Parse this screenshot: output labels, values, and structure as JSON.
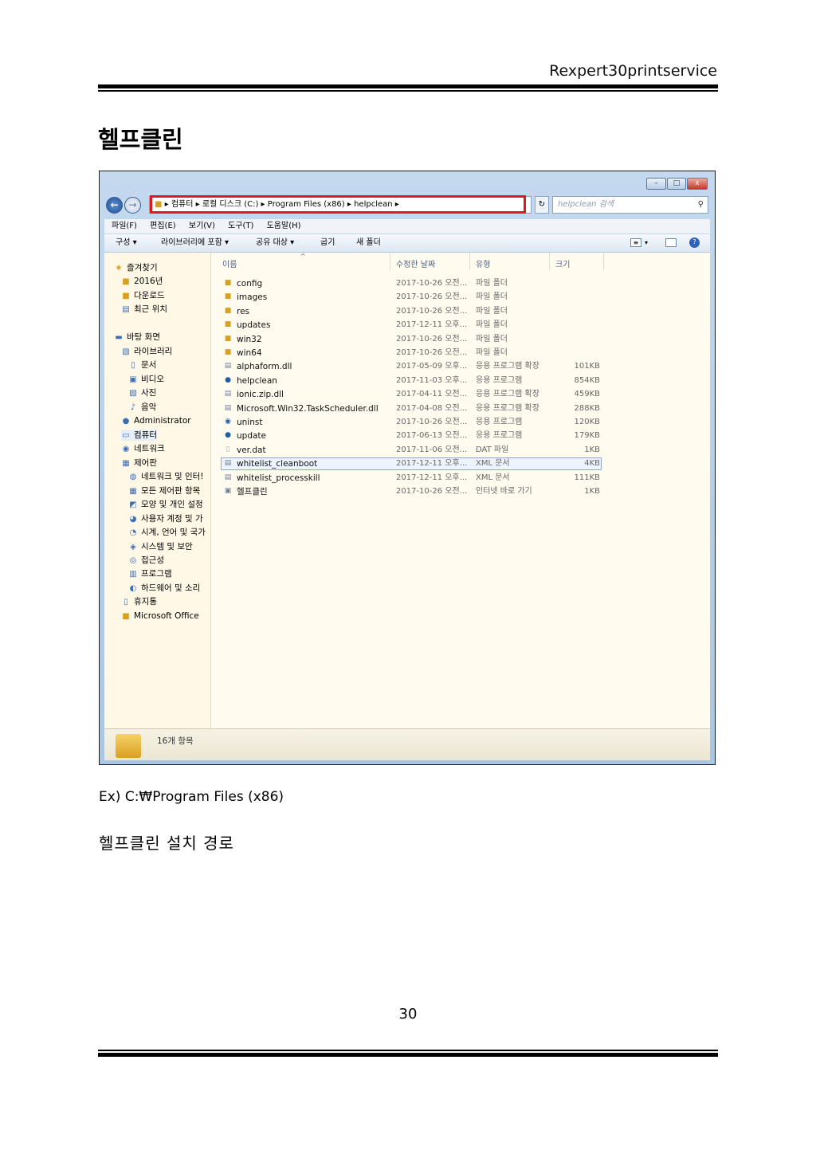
{
  "header": {
    "doc_title": "Rexpert30printservice"
  },
  "heading": "헬프클린",
  "window": {
    "controls": {
      "minimize": "–",
      "maximize": "□",
      "close": "x"
    },
    "nav": {
      "back_icon": "back-arrow-icon",
      "forward_icon": "forward-arrow-icon"
    },
    "address": {
      "segments": [
        "컴퓨터",
        "로컬 디스크 (C:)",
        "Program Files (x86)",
        "helpclean"
      ]
    },
    "search_placeholder": "helpclean 검색",
    "menu": [
      "파일(F)",
      "편집(E)",
      "보기(V)",
      "도구(T)",
      "도움말(H)"
    ],
    "commands": [
      "구성 ▾",
      "라이브러리에 포함 ▾",
      "공유 대상 ▾",
      "굽기",
      "새 폴더"
    ],
    "sidebar": [
      {
        "label": "즐겨찾기",
        "icon": "star-icon",
        "indent": 0
      },
      {
        "label": "2016년",
        "icon": "folder-icon",
        "indent": 1
      },
      {
        "label": "다운로드",
        "icon": "download-folder-icon",
        "indent": 1
      },
      {
        "label": "최근 위치",
        "icon": "recent-places-icon",
        "indent": 1
      },
      {
        "label": "바탕 화면",
        "icon": "desktop-icon",
        "indent": 0
      },
      {
        "label": "라이브러리",
        "icon": "library-icon",
        "indent": 1
      },
      {
        "label": "문서",
        "icon": "document-icon",
        "indent": 2
      },
      {
        "label": "비디오",
        "icon": "video-icon",
        "indent": 2
      },
      {
        "label": "사진",
        "icon": "picture-icon",
        "indent": 2
      },
      {
        "label": "음악",
        "icon": "music-icon",
        "indent": 2
      },
      {
        "label": "Administrator",
        "icon": "user-icon",
        "indent": 1
      },
      {
        "label": "컴퓨터",
        "icon": "computer-icon",
        "indent": 1
      },
      {
        "label": "네트워크",
        "icon": "network-icon",
        "indent": 1
      },
      {
        "label": "제어판",
        "icon": "control-panel-icon",
        "indent": 1
      },
      {
        "label": "네트워크 및 인터!",
        "icon": "network-internet-icon",
        "indent": 2
      },
      {
        "label": "모든 제어판 항목",
        "icon": "control-panel-items-icon",
        "indent": 2
      },
      {
        "label": "모양 및 개인 설정",
        "icon": "appearance-icon",
        "indent": 2
      },
      {
        "label": "사용자 계정 및 가",
        "icon": "user-accounts-icon",
        "indent": 2
      },
      {
        "label": "시계, 언어 및 국가",
        "icon": "clock-language-icon",
        "indent": 2
      },
      {
        "label": "시스템 및 보안",
        "icon": "system-security-icon",
        "indent": 2
      },
      {
        "label": "접근성",
        "icon": "accessibility-icon",
        "indent": 2
      },
      {
        "label": "프로그램",
        "icon": "programs-icon",
        "indent": 2
      },
      {
        "label": "하드웨어 및 소리",
        "icon": "hardware-sound-icon",
        "indent": 2
      },
      {
        "label": "휴지통",
        "icon": "recycle-bin-icon",
        "indent": 1
      },
      {
        "label": "Microsoft Office",
        "icon": "folder-icon",
        "indent": 1
      }
    ],
    "columns": {
      "name": "이름",
      "date": "수정한 날짜",
      "type": "유형",
      "size": "크기"
    },
    "files": [
      {
        "name": "config",
        "date": "2017-10-26 오전...",
        "type": "파일 폴더",
        "size": "",
        "icon": "folder-icon"
      },
      {
        "name": "images",
        "date": "2017-10-26 오전...",
        "type": "파일 폴더",
        "size": "",
        "icon": "folder-icon"
      },
      {
        "name": "res",
        "date": "2017-10-26 오전...",
        "type": "파일 폴더",
        "size": "",
        "icon": "folder-icon"
      },
      {
        "name": "updates",
        "date": "2017-12-11 오후...",
        "type": "파일 폴더",
        "size": "",
        "icon": "folder-icon"
      },
      {
        "name": "win32",
        "date": "2017-10-26 오전...",
        "type": "파일 폴더",
        "size": "",
        "icon": "folder-icon"
      },
      {
        "name": "win64",
        "date": "2017-10-26 오전...",
        "type": "파일 폴더",
        "size": "",
        "icon": "folder-icon"
      },
      {
        "name": "alphaform.dll",
        "date": "2017-05-09 오후...",
        "type": "응용 프로그램 확장",
        "size": "101KB",
        "icon": "dll-icon"
      },
      {
        "name": "helpclean",
        "date": "2017-11-03 오후...",
        "type": "응용 프로그램",
        "size": "854KB",
        "icon": "app-icon"
      },
      {
        "name": "ionic.zip.dll",
        "date": "2017-04-11 오전...",
        "type": "응용 프로그램 확장",
        "size": "459KB",
        "icon": "dll-icon"
      },
      {
        "name": "Microsoft.Win32.TaskScheduler.dll",
        "date": "2017-04-08 오전...",
        "type": "응용 프로그램 확장",
        "size": "288KB",
        "icon": "dll-icon"
      },
      {
        "name": "uninst",
        "date": "2017-10-26 오전...",
        "type": "응용 프로그램",
        "size": "120KB",
        "icon": "uninstall-icon"
      },
      {
        "name": "update",
        "date": "2017-06-13 오전...",
        "type": "응용 프로그램",
        "size": "179KB",
        "icon": "app-icon"
      },
      {
        "name": "ver.dat",
        "date": "2017-11-06 오전...",
        "type": "DAT 파일",
        "size": "1KB",
        "icon": "file-icon"
      },
      {
        "name": "whitelist_cleanboot",
        "date": "2017-12-11 오후...",
        "type": "XML 문서",
        "size": "4KB",
        "icon": "xml-icon"
      },
      {
        "name": "whitelist_processkill",
        "date": "2017-12-11 오후...",
        "type": "XML 문서",
        "size": "111KB",
        "icon": "xml-icon"
      },
      {
        "name": "헬프클린",
        "date": "2017-10-26 오전...",
        "type": "인터넷 바로 가기",
        "size": "1KB",
        "icon": "shortcut-icon"
      }
    ],
    "status": "16개 항목"
  },
  "example_path": "Ex) C:₩Program Files (x86)",
  "caption": "헬프클린 설치 경로",
  "page_number": "30"
}
